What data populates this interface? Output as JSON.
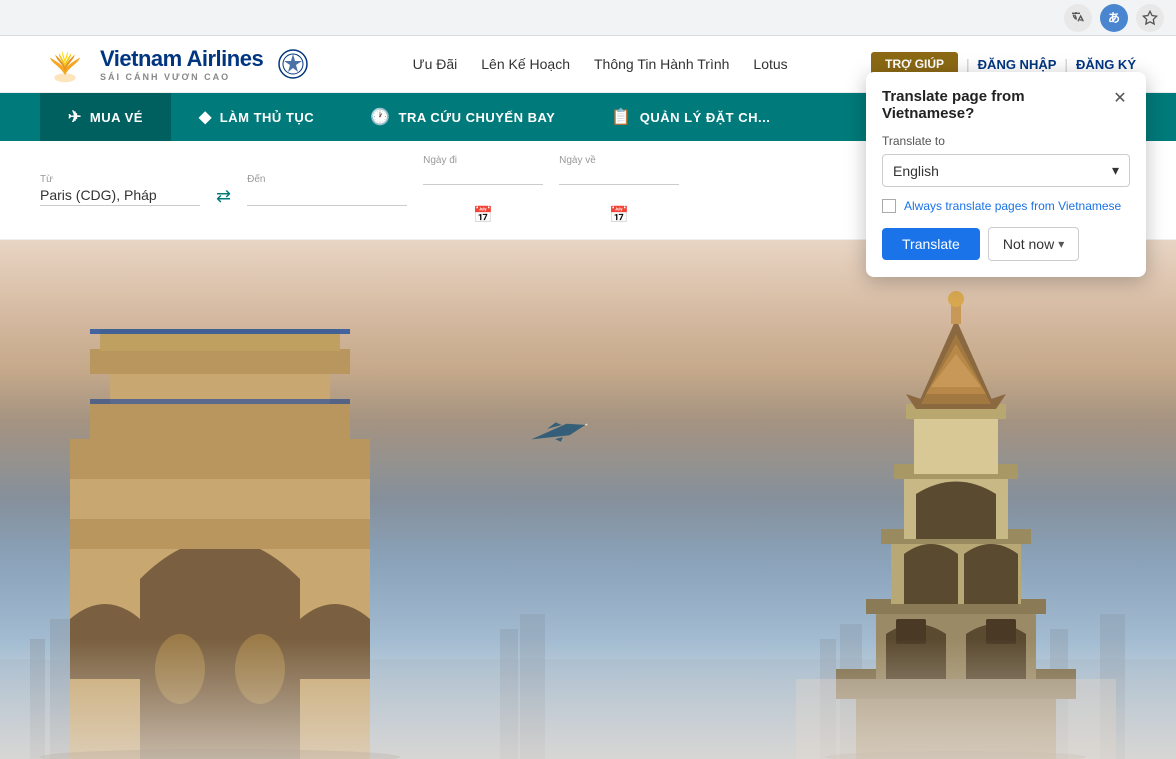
{
  "browser": {
    "icons": [
      "translate",
      "profile",
      "star"
    ]
  },
  "header": {
    "logo_main": "Vietnam Airlines",
    "logo_sub": "SÁI CÁNH VƯƠN CAO",
    "nav_links": [
      {
        "label": "Ưu Đãi"
      },
      {
        "label": "Lên Kế Hoạch"
      },
      {
        "label": "Thông Tin Hành Trình"
      },
      {
        "label": "Lotus"
      }
    ],
    "actions": {
      "tro_giup": "TRỢ GIÚP",
      "dang_nhap": "ĐĂNG NHẬP",
      "dang_ky": "ĐĂNG KÝ"
    }
  },
  "nav_tabs": [
    {
      "label": "MUA VÉ",
      "icon": "✈",
      "active": true
    },
    {
      "label": "LÀM THỦ TỤC",
      "icon": "◆"
    },
    {
      "label": "TRA CỨU CHUYẾN BAY",
      "icon": "🕐"
    },
    {
      "label": "QUẢN LÝ ĐẶT CH...",
      "icon": "📋"
    }
  ],
  "search": {
    "from_label": "Từ",
    "from_value": "Paris (CDG), Pháp",
    "to_label": "Đến",
    "to_placeholder": "",
    "depart_label": "Ngày đi",
    "return_label": "Ngày về"
  },
  "translate_popup": {
    "title": "Translate page from Vietnamese?",
    "translate_to_label": "Translate to",
    "language": "English",
    "always_translate_text": "Always translate pages from",
    "always_translate_lang": "Vietnamese",
    "translate_btn": "Translate",
    "not_now_btn": "Not now"
  }
}
